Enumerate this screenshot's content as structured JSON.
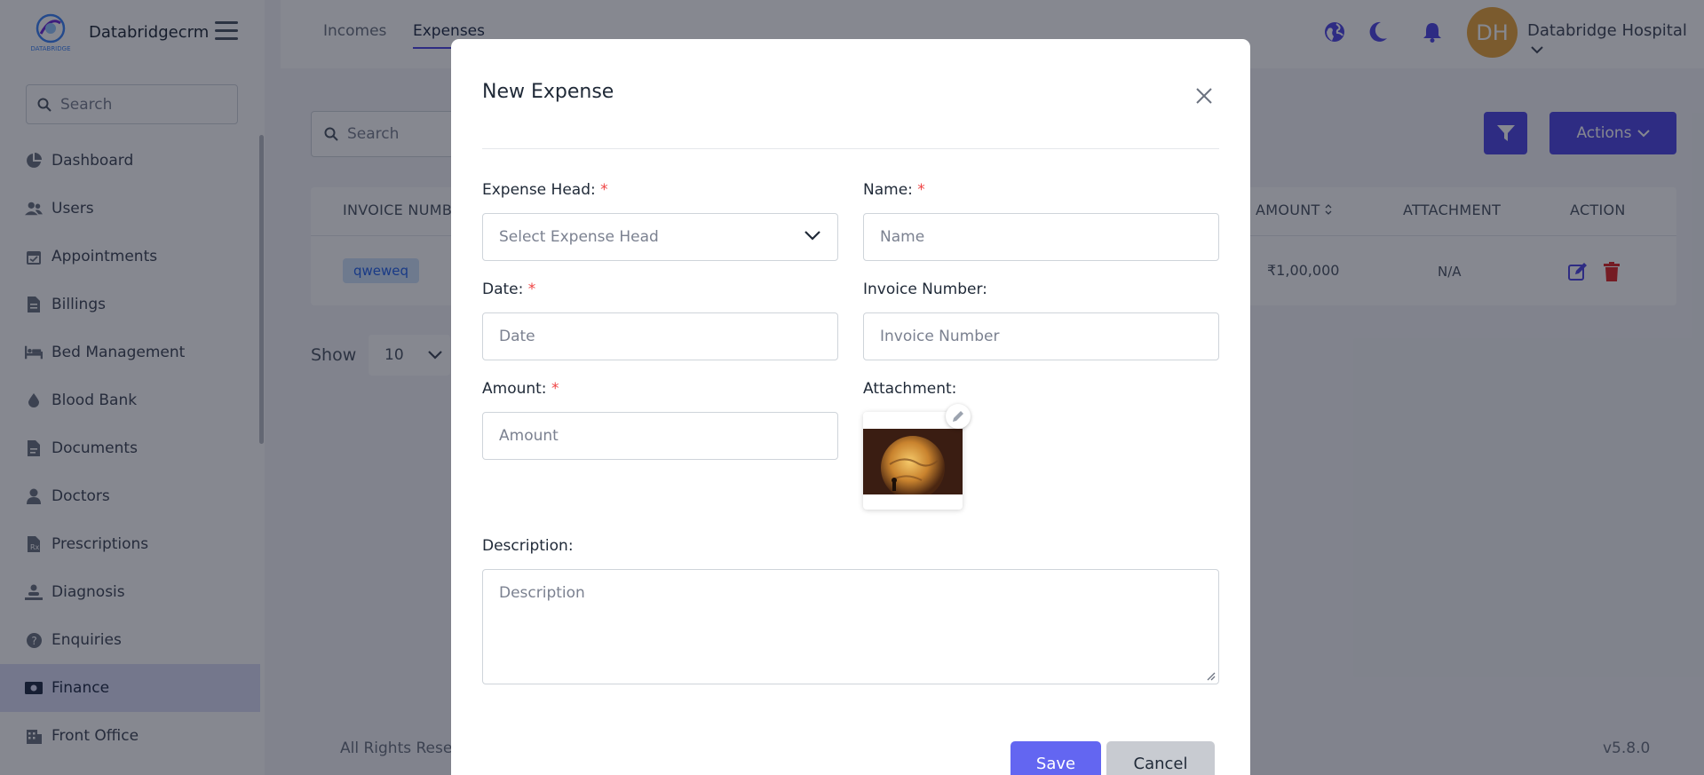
{
  "brand": {
    "name": "Databridgecrm",
    "logo_text": "DATABRIDGE"
  },
  "sidebar": {
    "search_placeholder": "Search",
    "items": [
      {
        "label": "Dashboard",
        "icon": "pie-chart-icon"
      },
      {
        "label": "Users",
        "icon": "users-icon"
      },
      {
        "label": "Appointments",
        "icon": "calendar-icon"
      },
      {
        "label": "Billings",
        "icon": "file-invoice-icon"
      },
      {
        "label": "Bed Management",
        "icon": "bed-icon"
      },
      {
        "label": "Blood Bank",
        "icon": "blood-drop-icon"
      },
      {
        "label": "Documents",
        "icon": "document-icon"
      },
      {
        "label": "Doctors",
        "icon": "doctor-icon"
      },
      {
        "label": "Prescriptions",
        "icon": "prescription-icon"
      },
      {
        "label": "Diagnosis",
        "icon": "diagnosis-icon"
      },
      {
        "label": "Enquiries",
        "icon": "question-icon"
      },
      {
        "label": "Finance",
        "icon": "money-icon",
        "active": true
      },
      {
        "label": "Front Office",
        "icon": "building-icon"
      }
    ]
  },
  "topbar": {
    "tabs": [
      {
        "label": "Incomes"
      },
      {
        "label": "Expenses",
        "active": true
      }
    ],
    "avatar_initials": "DH",
    "user_name": "Databridge Hospital"
  },
  "content": {
    "search_placeholder": "Search",
    "actions_label": "Actions",
    "table": {
      "headers": [
        "INVOICE NUMBER",
        "AMOUNT",
        "ATTACHMENT",
        "ACTION"
      ],
      "rows": [
        {
          "invoice": "qweweq",
          "amount": "₹1,00,000",
          "attachment": "N/A"
        }
      ]
    },
    "show_label": "Show",
    "page_size": "10",
    "footer_text": "All Rights Reserved",
    "version": "v5.8.0"
  },
  "modal": {
    "title": "New Expense",
    "expense_head_label": "Expense Head:",
    "expense_head_placeholder": "Select Expense Head",
    "name_label": "Name:",
    "name_placeholder": "Name",
    "date_label": "Date:",
    "date_placeholder": "Date",
    "invoice_label": "Invoice Number:",
    "invoice_placeholder": "Invoice Number",
    "amount_label": "Amount:",
    "amount_placeholder": "Amount",
    "attachment_label": "Attachment:",
    "description_label": "Description:",
    "description_placeholder": "Description",
    "required_mark": "*",
    "save_label": "Save",
    "cancel_label": "Cancel"
  },
  "colors": {
    "primary": "#4f46e5",
    "save": "#6366f1",
    "required": "#ef4444",
    "delete": "#dc2626"
  }
}
